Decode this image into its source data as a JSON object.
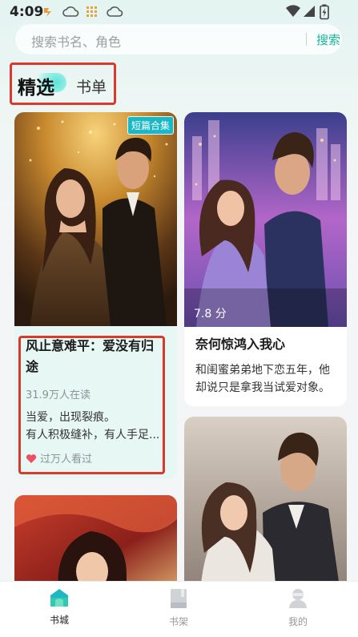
{
  "status": {
    "time": "4:09",
    "icons": [
      "app-notification-icon",
      "cloud-icon",
      "grid-icon",
      "cloud-icon",
      "wifi-icon",
      "signal-icon",
      "battery-icon"
    ]
  },
  "search": {
    "placeholder": "搜索书名、角色",
    "button": "搜索"
  },
  "tabs": [
    {
      "label": "精选",
      "selected": true
    },
    {
      "label": "书单",
      "selected": false
    }
  ],
  "books": [
    {
      "badge": "短篇合集",
      "title_line1": "风止意难平：爱没有归",
      "title_line2": "途",
      "readers": "31.9万人在读",
      "desc_line1": "当爱，出现裂痕。",
      "desc_line2": "有人积极缝补，有人手足...",
      "viewed": "过万人看过"
    },
    {
      "score": "7.8 分",
      "title": "奈何惊鸿入我心",
      "desc_line1": "和闺蜜弟弟地下恋五年，他",
      "desc_line2": "却说只是拿我当试爱对象。"
    }
  ],
  "nav": [
    {
      "label": "书城",
      "active": true,
      "icon": "home-icon"
    },
    {
      "label": "书架",
      "active": false,
      "icon": "bookshelf-icon"
    },
    {
      "label": "我的",
      "active": false,
      "icon": "profile-icon"
    }
  ],
  "colors": {
    "accent": "#18b79a",
    "badge": "#19b8c7",
    "highlight": "#d93a2b",
    "heart": "#ee4f63"
  }
}
